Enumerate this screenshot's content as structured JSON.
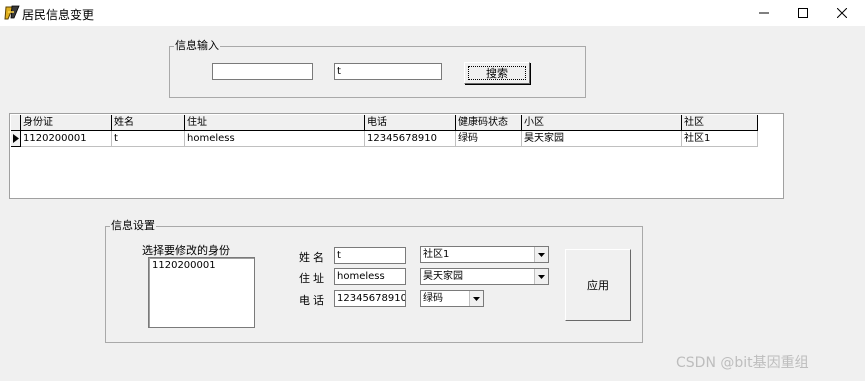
{
  "window": {
    "title": "居民信息变更"
  },
  "info_input": {
    "group_title": "信息输入",
    "field1_value": "",
    "field2_value": "t",
    "search_label": "搜索"
  },
  "grid": {
    "columns": [
      "身份证",
      "姓名",
      "住址",
      "电话",
      "健康码状态",
      "小区",
      "社区"
    ],
    "rows": [
      [
        "1120200001",
        "t",
        "homeless",
        "12345678910",
        "绿码",
        "昊天家园",
        "社区1"
      ]
    ]
  },
  "info_settings": {
    "group_title": "信息设置",
    "list_label": "选择要修改的身份",
    "list_items": [
      "1120200001"
    ],
    "name_label": "姓名",
    "name_value": "t",
    "address_label": "住址",
    "address_value": "homeless",
    "phone_label": "电话",
    "phone_value": "12345678910",
    "community_selected": "社区1",
    "estate_selected": "昊天家园",
    "health_code_selected": "绿码",
    "apply_label": "应用"
  },
  "watermark": "CSDN @bit基因重组",
  "icons": {
    "app": "app-icon",
    "minimize": "minimize-icon",
    "maximize": "maximize-icon",
    "close": "close-icon",
    "row_indicator": "row-indicator-icon",
    "dropdown": "chevron-down-icon"
  }
}
